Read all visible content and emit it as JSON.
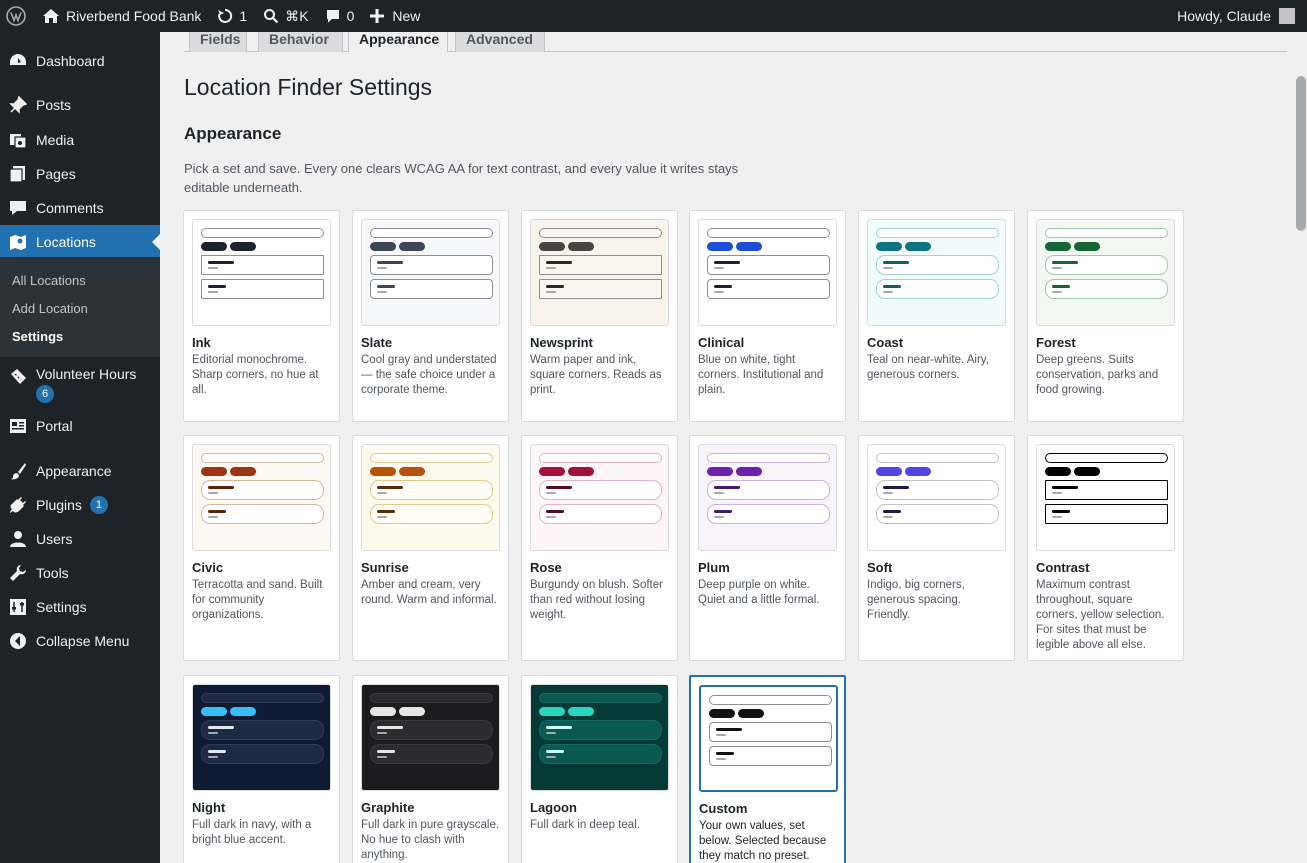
{
  "admin_bar": {
    "site_name": "Riverbend Food Bank",
    "updates_count": "1",
    "search_shortcut": "⌘K",
    "comments_count": "0",
    "new_label": "New",
    "greeting": "Howdy, Claude"
  },
  "sidebar": {
    "items": [
      {
        "label": "Dashboard",
        "icon": "dashboard-icon"
      },
      {
        "label": "Posts",
        "icon": "pin-icon"
      },
      {
        "label": "Media",
        "icon": "media-icon"
      },
      {
        "label": "Pages",
        "icon": "pages-icon"
      },
      {
        "label": "Comments",
        "icon": "comment-icon"
      },
      {
        "label": "Locations",
        "icon": "map-icon"
      },
      {
        "label": "Volunteer Hours",
        "icon": "ticket-icon",
        "badge": "6"
      },
      {
        "label": "Portal",
        "icon": "portal-icon"
      },
      {
        "label": "Appearance",
        "icon": "brush-icon"
      },
      {
        "label": "Plugins",
        "icon": "plugin-icon",
        "badge": "1"
      },
      {
        "label": "Users",
        "icon": "user-icon"
      },
      {
        "label": "Tools",
        "icon": "wrench-icon"
      },
      {
        "label": "Settings",
        "icon": "sliders-icon"
      },
      {
        "label": "Collapse Menu",
        "icon": "collapse-icon"
      }
    ],
    "submenu": [
      "All Locations",
      "Add Location",
      "Settings"
    ]
  },
  "tabs": [
    "Fields",
    "Behavior",
    "Appearance",
    "Advanced"
  ],
  "page_title": "Location Finder Settings",
  "section_title": "Appearance",
  "intro": "Pick a set and save. Every one clears WCAG AA for text contrast, and every value it writes stays editable underneath.",
  "presets": [
    {
      "name": "Ink",
      "desc": "Editorial monochrome. Sharp corners, no hue at all.",
      "colors": {
        "bg": "#ffffff",
        "chip": "#1d2130",
        "line": "#1d2130",
        "box": "#ffffff",
        "boxBorder": "#8c8f94"
      }
    },
    {
      "name": "Slate",
      "desc": "Cool gray and understated — the safe choice under a corporate theme.",
      "colors": {
        "bg": "#f6f7f9",
        "chip": "#3c4657",
        "line": "#3c4657",
        "box": "#ffffff",
        "boxBorder": "#8c8f94"
      }
    },
    {
      "name": "Newsprint",
      "desc": "Warm paper and ink, square corners. Reads as print.",
      "colors": {
        "bg": "#f8f4ec",
        "chip": "#4a4340",
        "line": "#2c2826",
        "box": "#faf7ef",
        "boxBorder": "#8c8f94"
      }
    },
    {
      "name": "Clinical",
      "desc": "Blue on white, tight corners. Institutional and plain.",
      "colors": {
        "bg": "#ffffff",
        "chip": "#1d4ed8",
        "line": "#1d2130",
        "box": "#ffffff",
        "boxBorder": "#8c8f94"
      }
    },
    {
      "name": "Coast",
      "desc": "Teal on near-white. Airy, generous corners.",
      "colors": {
        "bg": "#f1fbfc",
        "chip": "#0f7386",
        "line": "#0f5e6b",
        "box": "#ffffff",
        "boxBorder": "#9ed4da"
      }
    },
    {
      "name": "Forest",
      "desc": "Deep greens. Suits conservation, parks and food growing.",
      "colors": {
        "bg": "#f3f8f2",
        "chip": "#166534",
        "line": "#166534",
        "box": "#ffffff",
        "boxBorder": "#a3c9a8"
      }
    },
    {
      "name": "Civic",
      "desc": "Terracotta and sand. Built for community organizations.",
      "colors": {
        "bg": "#fdf8f1",
        "chip": "#9a3412",
        "line": "#5b2408",
        "box": "#ffffff",
        "boxBorder": "#d6b8a2"
      }
    },
    {
      "name": "Sunrise",
      "desc": "Amber and cream, very round. Warm and informal.",
      "colors": {
        "bg": "#fefaee",
        "chip": "#b45309",
        "line": "#5b2a06",
        "box": "#fffdf6",
        "boxBorder": "#e5c98f"
      }
    },
    {
      "name": "Rose",
      "desc": "Burgundy on blush. Softer than red without losing weight.",
      "colors": {
        "bg": "#fdf5f7",
        "chip": "#9f1239",
        "line": "#5a0b22",
        "box": "#ffffff",
        "boxBorder": "#e3b4c1"
      }
    },
    {
      "name": "Plum",
      "desc": "Deep purple on white. Quiet and a little formal.",
      "colors": {
        "bg": "#f8f3fc",
        "chip": "#6b21a8",
        "line": "#4a1675",
        "box": "#ffffff",
        "boxBorder": "#c9b3dc"
      }
    },
    {
      "name": "Soft",
      "desc": "Indigo, big corners, generous spacing. Friendly.",
      "colors": {
        "bg": "#ffffff",
        "chip": "#4f46e5",
        "line": "#1e1b4b",
        "box": "#ffffff",
        "boxBorder": "#c3c4c7"
      }
    },
    {
      "name": "Contrast",
      "desc": "Maximum contrast throughout, square corners, yellow selection. For sites that must be legible above all else.",
      "colors": {
        "bg": "#ffffff",
        "chip": "#000000",
        "line": "#000000",
        "box": "#ffffff",
        "boxBorder": "#000000"
      }
    },
    {
      "name": "Night",
      "desc": "Full dark in navy, with a bright blue accent.",
      "colors": {
        "bg": "#0f1b33",
        "chip": "#38bdf8",
        "line": "#e2e8f0",
        "box": "#1e2a44",
        "boxBorder": "#2f3c58"
      }
    },
    {
      "name": "Graphite",
      "desc": "Full dark in pure grayscale. No hue to clash with anything.",
      "colors": {
        "bg": "#1c1c1e",
        "chip": "#e5e5e5",
        "line": "#e5e5e5",
        "box": "#2c2c2e",
        "boxBorder": "#3a3a3c"
      }
    },
    {
      "name": "Lagoon",
      "desc": "Full dark in deep teal.",
      "colors": {
        "bg": "#053a36",
        "chip": "#2dd4bf",
        "line": "#ccfbf1",
        "box": "#0b5a52",
        "boxBorder": "#0f6b62"
      }
    },
    {
      "name": "Custom",
      "desc": "Your own values, set below. Selected because they match no preset.",
      "selected": true,
      "colors": {
        "bg": "#ffffff",
        "chip": "#111111",
        "line": "#111111",
        "box": "#ffffff",
        "boxBorder": "#8c8f94"
      }
    }
  ],
  "accent_color": "#2271b1"
}
